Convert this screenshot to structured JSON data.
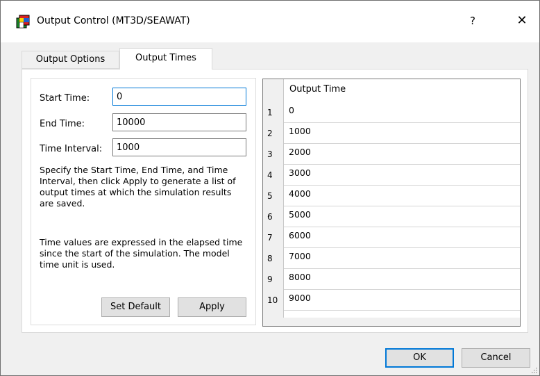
{
  "window": {
    "title": "Output Control (MT3D/SEAWAT)",
    "help_label": "?",
    "close_label": "✕"
  },
  "tabs": [
    {
      "label": "Output Options",
      "active": false
    },
    {
      "label": "Output Times",
      "active": true
    }
  ],
  "form": {
    "start_label": "Start Time:",
    "start_value": "0",
    "end_label": "End Time:",
    "end_value": "10000",
    "interval_label": "Time Interval:",
    "interval_value": "1000",
    "desc1": "Specify the Start Time, End Time, and Time Interval, then click Apply to generate a list of output times at which the simulation results are saved.",
    "desc2": "Time values are expressed in the elapsed time since the start of the simulation. The model time unit is used.",
    "set_default_label": "Set Default",
    "apply_label": "Apply"
  },
  "grid": {
    "header": "Output Time",
    "rows": [
      {
        "num": "1",
        "value": "0"
      },
      {
        "num": "2",
        "value": "1000"
      },
      {
        "num": "3",
        "value": "2000"
      },
      {
        "num": "4",
        "value": "3000"
      },
      {
        "num": "5",
        "value": "4000"
      },
      {
        "num": "6",
        "value": "5000"
      },
      {
        "num": "7",
        "value": "6000"
      },
      {
        "num": "8",
        "value": "7000"
      },
      {
        "num": "9",
        "value": "8000"
      },
      {
        "num": "10",
        "value": "9000"
      }
    ]
  },
  "footer": {
    "ok_label": "OK",
    "cancel_label": "Cancel"
  },
  "colors": {
    "accent": "#0078d7",
    "face": "#f0f0f0"
  },
  "icons": [
    "app-icon",
    "help-icon",
    "close-icon",
    "resize-grip-icon"
  ]
}
